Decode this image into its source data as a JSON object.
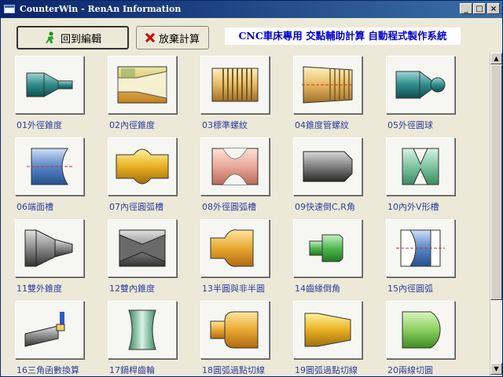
{
  "window": {
    "title": "CounterWin - RenAn Information",
    "buttons": [
      "_",
      "□",
      "×"
    ]
  },
  "toolbar": {
    "back_label": "回到編輯",
    "discard_label": "放棄計算",
    "banner": "CNC車床專用  交點輔助計算  自動程式製作系統"
  },
  "items": [
    {
      "label": "01外徑錐度"
    },
    {
      "label": "02內徑錐度"
    },
    {
      "label": "03標準螺紋"
    },
    {
      "label": "04錐度管螺紋"
    },
    {
      "label": "05外徑圓球"
    },
    {
      "label": "06端面槽"
    },
    {
      "label": "07內徑圓弧槽"
    },
    {
      "label": "08外徑圓弧槽"
    },
    {
      "label": "09快速倒C,R角"
    },
    {
      "label": "10內外V形槽"
    },
    {
      "label": "11雙外錐度"
    },
    {
      "label": "12雙內錐度"
    },
    {
      "label": "13半圓與非半圓"
    },
    {
      "label": "14齒緣倒角"
    },
    {
      "label": "15內徑圓弧"
    },
    {
      "label": "16三角函數換算"
    },
    {
      "label": "17鍋桿齒輪"
    },
    {
      "label": "18圓弧過點切線"
    },
    {
      "label": "19圓弧過點切線"
    },
    {
      "label": "20兩線切圓"
    }
  ],
  "colors": {
    "titlebar": "#0a246a",
    "banner_text": "#0000cc",
    "caption_text": "#3040a0"
  }
}
